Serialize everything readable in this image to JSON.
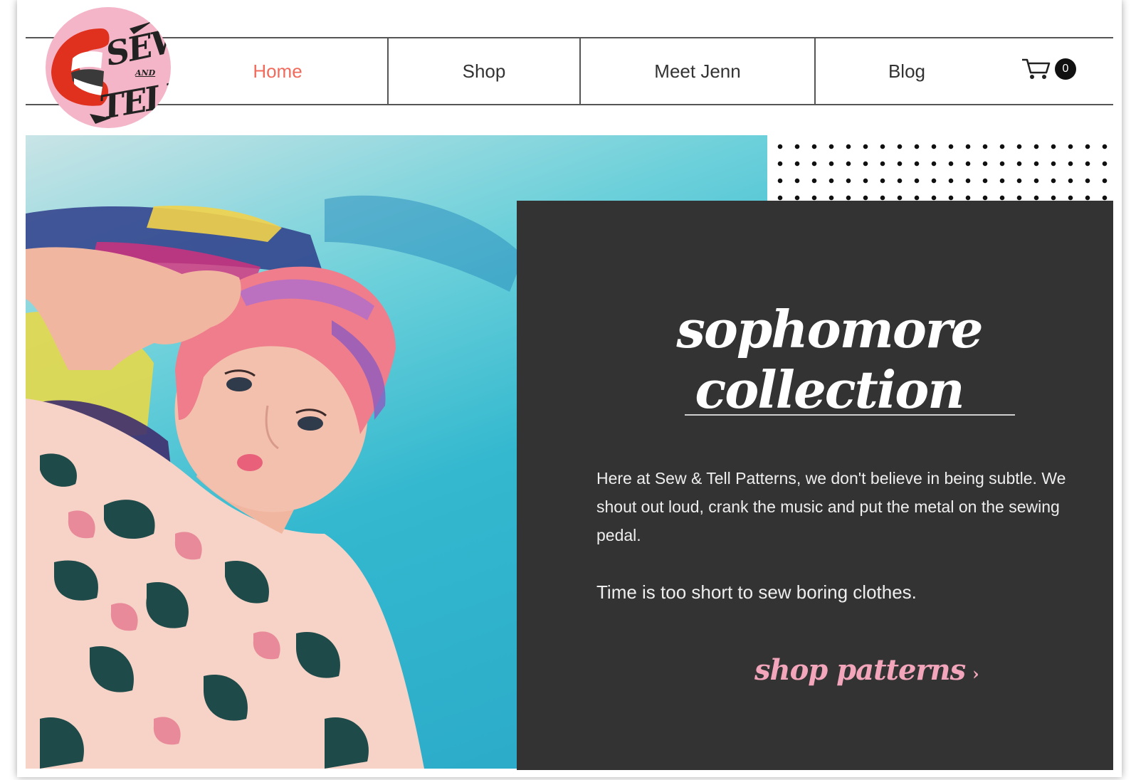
{
  "brand": {
    "logo_top": "SEW",
    "logo_mid": "AND",
    "logo_bot": "TELL",
    "logo_bg_color": "#f3b5c7",
    "lips_color": "#e0301e"
  },
  "nav": {
    "items": [
      {
        "label": "Home",
        "active": true
      },
      {
        "label": "Shop",
        "active": false
      },
      {
        "label": "Meet Jenn",
        "active": false
      },
      {
        "label": "Blog",
        "active": false
      }
    ],
    "active_color": "#f06b5c",
    "cart": {
      "icon": "cart-icon",
      "count": "0"
    }
  },
  "hero": {
    "image": "woman-with-pink-hair-portrait",
    "title": "sophomore collection",
    "paragraph_1": "Here at Sew & Tell Patterns, we don't believe in being subtle. We shout out loud, crank the music and put the metal on the sewing pedal.",
    "paragraph_2": "Time is too short to sew boring clothes.",
    "cta_label": "shop patterns",
    "cta_icon": "chevron-right-icon",
    "panel_color": "#333333",
    "cta_color": "#f3a6bb"
  }
}
